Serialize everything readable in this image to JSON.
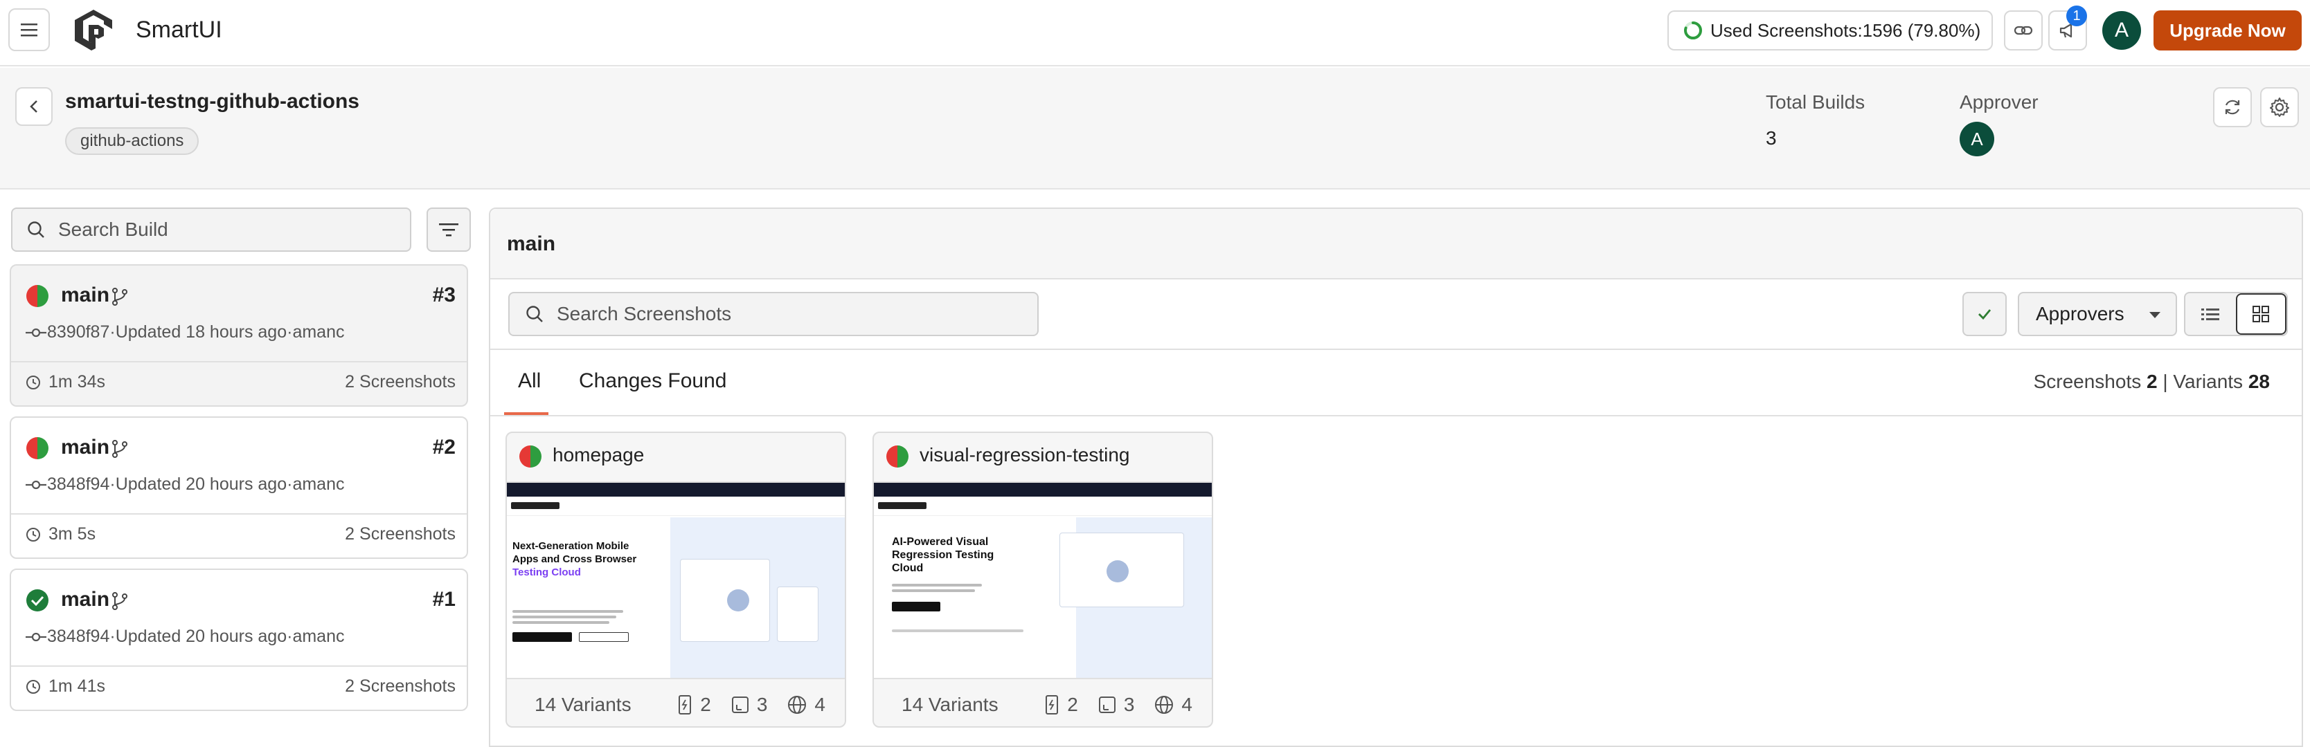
{
  "app": {
    "title": "SmartUI"
  },
  "topbar": {
    "usage_text": "Used Screenshots:1596 (79.80%)",
    "usage_fraction": 0.798,
    "notification_count": "1",
    "avatar_initial": "A",
    "upgrade_label": "Upgrade Now"
  },
  "project": {
    "name": "smartui-testng-github-actions",
    "tag": "github-actions",
    "total_builds_label": "Total Builds",
    "total_builds": "3",
    "approver_label": "Approver",
    "approver_initial": "A"
  },
  "sidebar": {
    "search_placeholder": "Search Build",
    "builds": [
      {
        "branch": "main",
        "number": "#3",
        "commit": "8390f87",
        "updated": "Updated 18 hours ago",
        "author": "amanc",
        "duration": "1m 34s",
        "screenshots": "2 Screenshots",
        "status": "changes"
      },
      {
        "branch": "main",
        "number": "#2",
        "commit": "3848f94",
        "updated": "Updated 20 hours ago",
        "author": "amanc",
        "duration": "3m 5s",
        "screenshots": "2 Screenshots",
        "status": "changes"
      },
      {
        "branch": "main",
        "number": "#1",
        "commit": "3848f94",
        "updated": "Updated 20 hours ago",
        "author": "amanc",
        "duration": "1m 41s",
        "screenshots": "2 Screenshots",
        "status": "approved"
      }
    ],
    "meta_separator": " · "
  },
  "main": {
    "title": "main",
    "search_placeholder": "Search Screenshots",
    "approvers_label": "Approvers",
    "tabs": [
      {
        "label": "All"
      },
      {
        "label": "Changes Found"
      }
    ],
    "counts": {
      "screenshots_label": "Screenshots",
      "screenshots": "2",
      "sep": "|",
      "variants_label": "Variants",
      "variants": "28"
    },
    "screenshots": [
      {
        "name": "homepage",
        "variants": "14 Variants",
        "devices": "2",
        "viewports": "3",
        "browsers": "4",
        "thumb": {
          "heading_line1": "Next-Generation Mobile",
          "heading_line2": "Apps and Cross Browser",
          "heading_highlight": "Testing Cloud"
        }
      },
      {
        "name": "visual-regression-testing",
        "variants": "14 Variants",
        "devices": "2",
        "viewports": "3",
        "browsers": "4",
        "thumb": {
          "heading_line1": "AI-Powered Visual",
          "heading_line2": "Regression Testing",
          "heading_highlight": "Cloud"
        }
      }
    ]
  },
  "colors": {
    "accent": "#c4480b",
    "approved": "#1e7d3a",
    "changed_red": "#e53935",
    "changed_green": "#2e9d3f",
    "tab_underline": "#e8694a",
    "badge": "#1a73e8"
  },
  "icons": [
    "menu-icon",
    "logo-icon",
    "link-icon",
    "megaphone-icon",
    "back-icon",
    "refresh-icon",
    "gear-icon",
    "search-icon",
    "filter-icon",
    "branch-icon",
    "commit-icon",
    "clock-icon",
    "check-icon",
    "list-view-icon",
    "grid-view-icon",
    "device-icon",
    "viewport-icon",
    "globe-icon"
  ]
}
